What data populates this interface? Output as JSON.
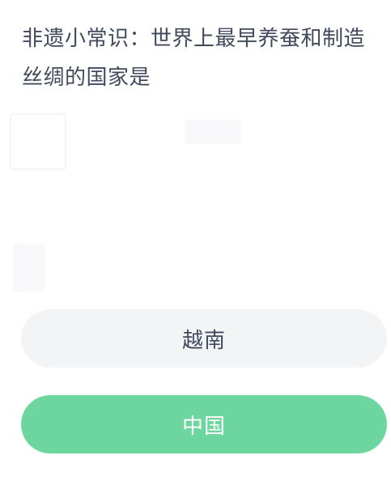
{
  "quiz": {
    "question": "非遗小常识：世界上最早养蚕和制造丝绸的国家是",
    "options": [
      {
        "label": "越南",
        "state": "default"
      },
      {
        "label": "中国",
        "state": "correct"
      }
    ]
  },
  "colors": {
    "text": "#404a5c",
    "option_default_bg": "#f3f4f6",
    "option_correct_bg": "#6dd69f",
    "option_correct_text": "#ffffff"
  }
}
